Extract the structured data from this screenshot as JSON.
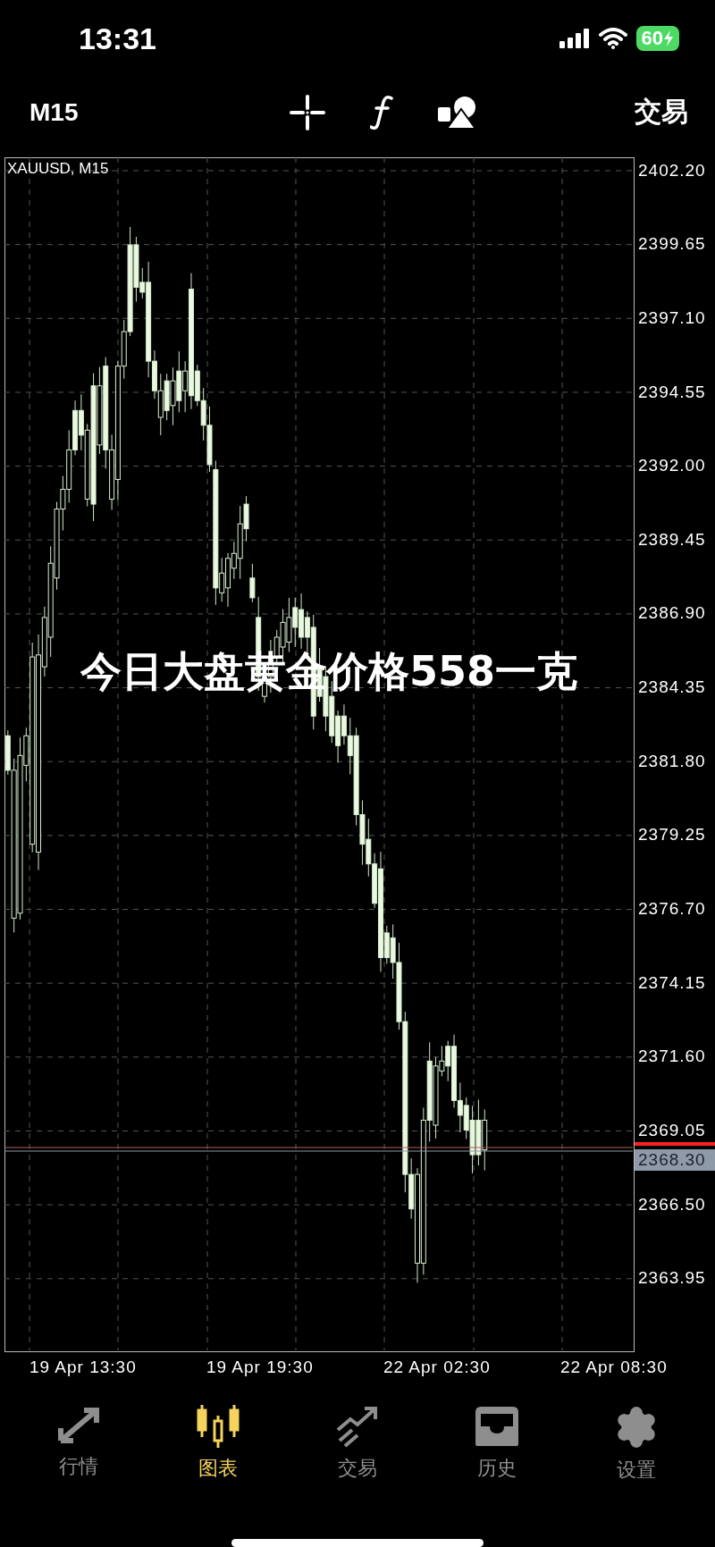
{
  "status_bar": {
    "time": "13:31",
    "battery": "60"
  },
  "toolbar": {
    "timeframe": "M15",
    "trade": "交易"
  },
  "chart": {
    "symbol": "XAUUSD, M15",
    "price_labels": [
      "2402.20",
      "2399.65",
      "2397.10",
      "2394.55",
      "2392.00",
      "2389.45",
      "2386.90",
      "2384.35",
      "2381.80",
      "2379.25",
      "2376.70",
      "2374.15",
      "2371.60",
      "2369.05",
      "2366.50",
      "2363.95"
    ],
    "current_price": "2368.30",
    "time_labels": [
      "19 Apr 13:30",
      "19 Apr 19:30",
      "22 Apr 02:30",
      "22 Apr 08:30"
    ]
  },
  "overlay_caption": "今日大盘黄金价格558一克",
  "tabs": [
    {
      "kind": "quotes",
      "label": "行情",
      "selected": false
    },
    {
      "kind": "chart",
      "label": "图表",
      "selected": true
    },
    {
      "kind": "trade",
      "label": "交易",
      "selected": false
    },
    {
      "kind": "history",
      "label": "历史",
      "selected": false
    },
    {
      "kind": "settings",
      "label": "设置",
      "selected": false
    }
  ]
}
